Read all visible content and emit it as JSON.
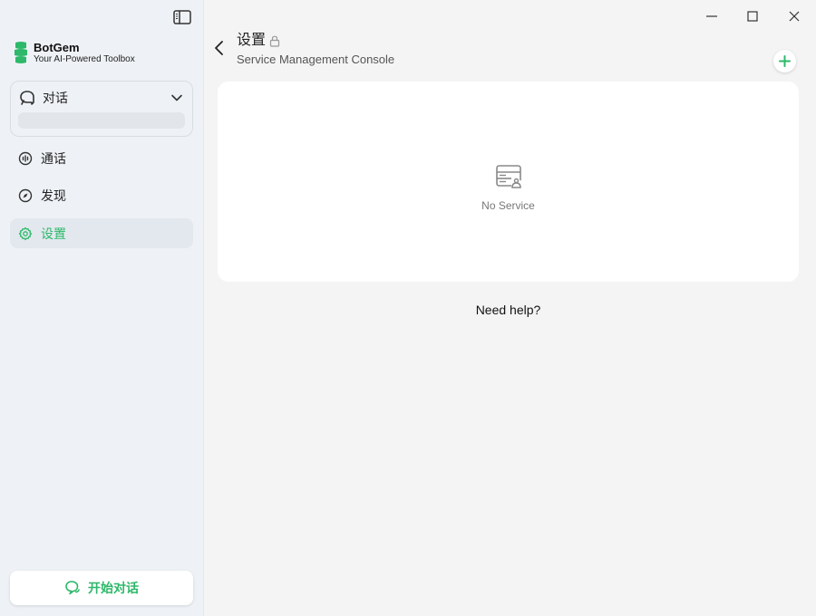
{
  "brand": {
    "name": "BotGem",
    "tagline": "Your AI-Powered Toolbox",
    "logo_color": "#2eb86a"
  },
  "sidebar": {
    "conversation_section": {
      "label": "对话"
    },
    "items": [
      {
        "label": "通话",
        "icon": "voice-call-icon",
        "active": false
      },
      {
        "label": "发现",
        "icon": "compass-icon",
        "active": false
      },
      {
        "label": "设置",
        "icon": "gear-icon",
        "active": true
      }
    ],
    "start_button": {
      "label": "开始对话"
    }
  },
  "header": {
    "title": "设置",
    "subtitle": "Service Management Console"
  },
  "service_panel": {
    "empty_text": "No Service"
  },
  "help": {
    "label": "Need help?"
  },
  "colors": {
    "accent": "#2eb86a",
    "sidebar_bg": "#eef2f6",
    "main_bg": "#f4f4f4"
  }
}
